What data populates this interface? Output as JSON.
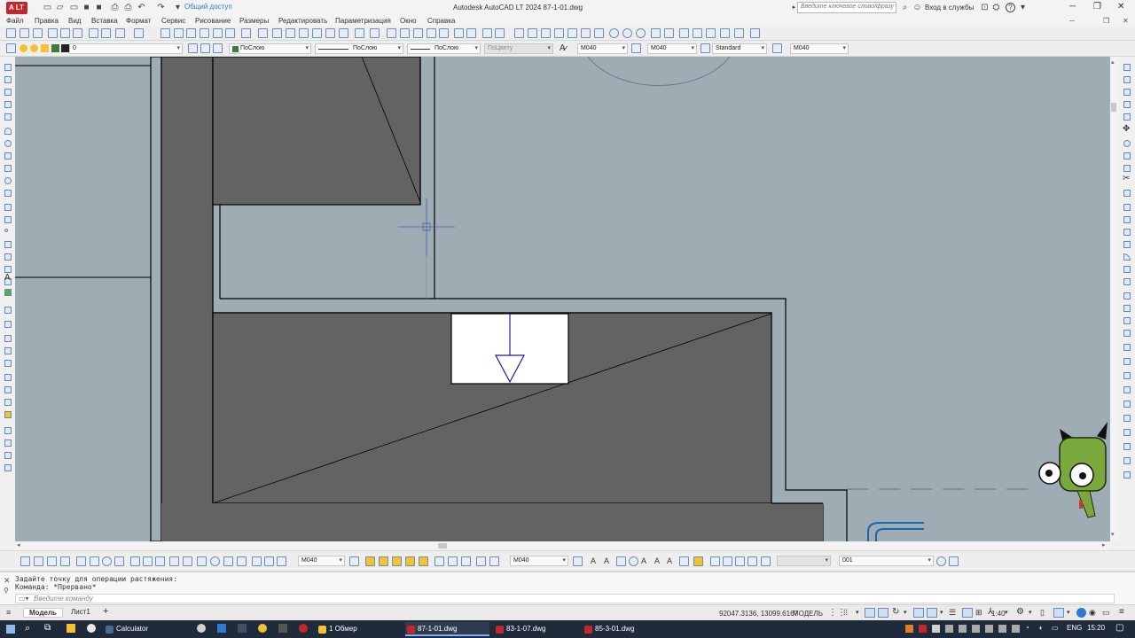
{
  "app": {
    "logo_text": "A LT",
    "title": "Autodesk AutoCAD LT 2024    87-1-01.dwg",
    "share": "Общий доступ",
    "search_placeholder": "Введите ключевое слово/фразу",
    "sign_in": "Вход в службы",
    "help": "?"
  },
  "menu": [
    "Файл",
    "Правка",
    "Вид",
    "Вставка",
    "Формат",
    "Сервис",
    "Рисование",
    "Размеры",
    "Редактировать",
    "Параметризация",
    "Окно",
    "Справка"
  ],
  "properties_bar": {
    "layer": "0",
    "color": "ПоСлою",
    "linetype": "ПоСлою",
    "lineweight": "ПоСлою",
    "plotstyle": "ПоЦвету",
    "text_style": "M040",
    "dim_style": "M040",
    "table_style": "Standard",
    "mleader_style": "M040"
  },
  "dim_toolbar": {
    "dim_style": "M040",
    "text_style": "M040",
    "layer_filter": "001"
  },
  "command": {
    "line1": "Задайте точку для операции растяжения:",
    "line2": "Команда: *Прервано*",
    "placeholder": "Введите команду"
  },
  "status": {
    "tab_model": "Модель",
    "tab_sheet": "Лист1",
    "add_tab": "+",
    "coords": "92047.3136, 13099.6167",
    "space": "МОДЕЛЬ",
    "scale": "1:40"
  },
  "taskbar": {
    "items": [
      "Calculator",
      "1 Обмер",
      "87-1-01.dwg",
      "83-1-07.dwg",
      "85-3-01.dwg"
    ],
    "lang": "ENG",
    "time": "15:20"
  },
  "colors": {
    "canvas": "#9eacb4",
    "fill_dark": "#636363",
    "outline": "#000000",
    "crosshair": "#4b5fb0",
    "block": "#1a1aa8"
  }
}
